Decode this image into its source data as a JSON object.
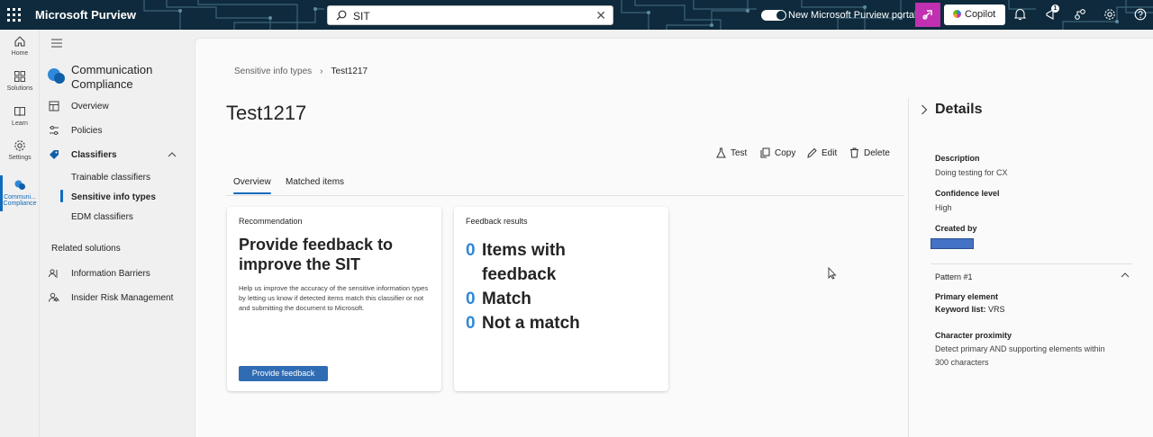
{
  "topbar": {
    "brand": "Microsoft Purview",
    "search_value": "SIT",
    "portal_toggle_label": "New Microsoft Purview portal",
    "copilot_label": "Copilot",
    "notification_count": "1"
  },
  "rail": {
    "items": [
      {
        "label": "Home",
        "icon": "home-icon"
      },
      {
        "label": "Solutions",
        "icon": "solutions-icon"
      },
      {
        "label": "Learn",
        "icon": "book-icon"
      },
      {
        "label": "Settings",
        "icon": "gear-icon"
      },
      {
        "label": "Communi...",
        "label2": "Compliance",
        "icon": "chat-icon"
      }
    ]
  },
  "nav": {
    "app_title": "Communication Compliance",
    "items": [
      {
        "label": "Overview",
        "icon": "overview-icon"
      },
      {
        "label": "Policies",
        "icon": "policies-icon"
      },
      {
        "label": "Classifiers",
        "icon": "tag-icon"
      }
    ],
    "sub_items": [
      "Trainable classifiers",
      "Sensitive info types",
      "EDM classifiers"
    ],
    "related_title": "Related solutions",
    "related": [
      {
        "label": "Information Barriers",
        "icon": "barrier-icon"
      },
      {
        "label": "Insider Risk Management",
        "icon": "person-risk-icon"
      }
    ]
  },
  "main": {
    "breadcrumb": [
      "Sensitive info types",
      "Test1217"
    ],
    "title": "Test1217",
    "toolbar": [
      "Test",
      "Copy",
      "Edit",
      "Delete"
    ],
    "tabs": [
      "Overview",
      "Matched items"
    ],
    "recommendation": {
      "header": "Recommendation",
      "title": "Provide feedback to improve the SIT",
      "description": "Help us improve the accuracy of the sensitive information types by letting us know if detected items match this classifier or not and submitting the document to Microsoft.",
      "button": "Provide feedback"
    },
    "feedback": {
      "header": "Feedback results",
      "rows": [
        {
          "count": "0",
          "label": "Items with",
          "label2": "feedback"
        },
        {
          "count": "0",
          "label": "Match"
        },
        {
          "count": "0",
          "label": "Not a match"
        }
      ]
    }
  },
  "details": {
    "title": "Details",
    "description_label": "Description",
    "description_value": "Doing testing for CX",
    "confidence_label": "Confidence level",
    "confidence_value": "High",
    "created_by_label": "Created by",
    "pattern_label": "Pattern #1",
    "primary_label": "Primary element",
    "keyword_label": "Keyword list:",
    "keyword_value": " VRS",
    "proximity_label": "Character proximity",
    "proximity_line1": "Detect primary AND supporting elements within",
    "proximity_line2": "300 characters"
  },
  "colors": {
    "accent": "#0f6cbd",
    "topbar": "#0e2a3c",
    "button": "#2f6cb3",
    "count": "#2f88d8"
  }
}
